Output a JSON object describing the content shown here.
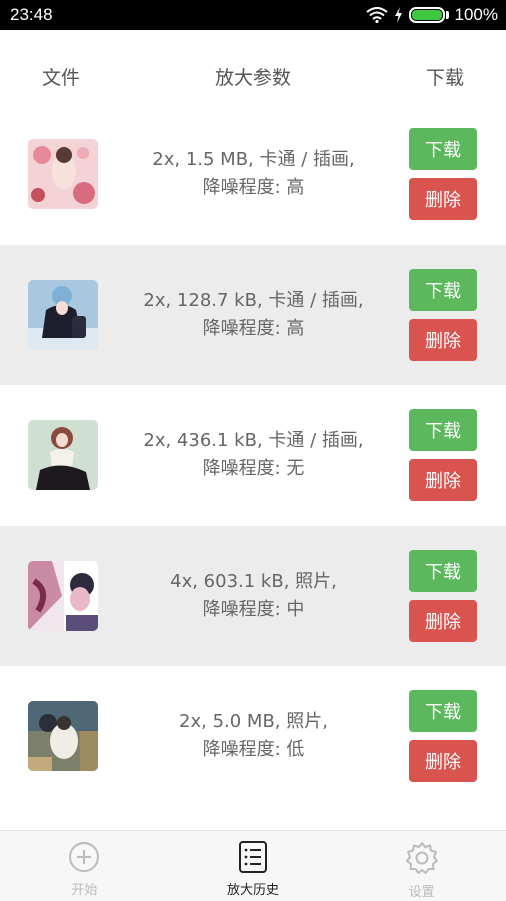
{
  "status": {
    "time": "23:48",
    "battery": "100%",
    "battery_level": 1.0
  },
  "header": {
    "col_file": "文件",
    "col_params": "放大参数",
    "col_download": "下载"
  },
  "rows": [
    {
      "line1": "2x, 1.5 MB, 卡通 / 插画,",
      "line2": "降噪程度: 高",
      "download": "下载",
      "delete": "删除"
    },
    {
      "line1": "2x, 128.7 kB, 卡通 / 插画,",
      "line2": "降噪程度: 高",
      "download": "下载",
      "delete": "删除"
    },
    {
      "line1": "2x, 436.1 kB, 卡通 / 插画,",
      "line2": "降噪程度: 无",
      "download": "下载",
      "delete": "删除"
    },
    {
      "line1": "4x, 603.1 kB, 照片,",
      "line2": "降噪程度: 中",
      "download": "下载",
      "delete": "删除"
    },
    {
      "line1": "2x, 5.0 MB, 照片,",
      "line2": "降噪程度: 低",
      "download": "下载",
      "delete": "删除"
    }
  ],
  "tabs": [
    {
      "label": "开始",
      "icon": "plus-circle-icon",
      "active": false
    },
    {
      "label": "放大历史",
      "icon": "list-icon",
      "active": true
    },
    {
      "label": "设置",
      "icon": "gear-icon",
      "active": false
    }
  ],
  "colors": {
    "download": "#5cb85c",
    "delete": "#d9534f",
    "alt_row": "#ececec"
  }
}
